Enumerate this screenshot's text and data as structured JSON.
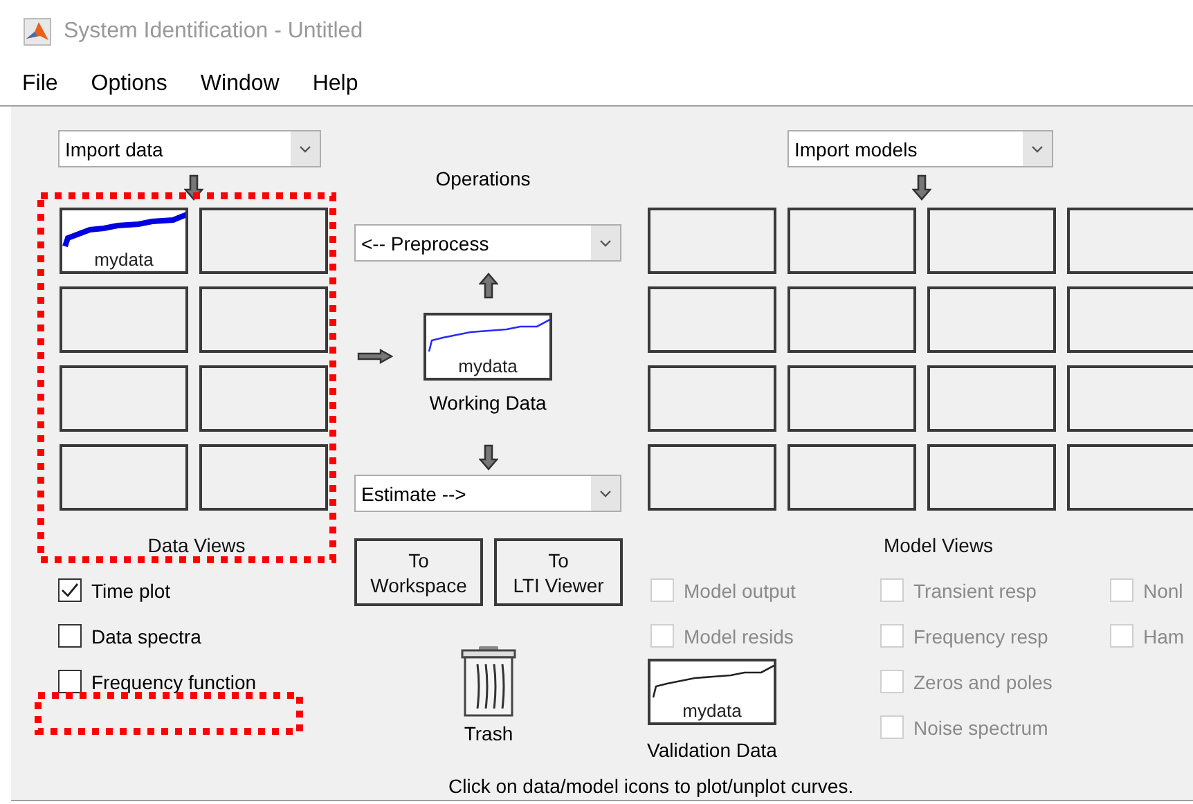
{
  "window": {
    "title": "System Identification - Untitled"
  },
  "menu": [
    "File",
    "Options",
    "Window",
    "Help"
  ],
  "data_section": {
    "dropdown": "Import data",
    "title": "Data Views",
    "tiles": [
      {
        "kind": "data",
        "label": "mydata"
      },
      {
        "kind": "empty"
      },
      {
        "kind": "empty"
      },
      {
        "kind": "empty"
      },
      {
        "kind": "empty"
      },
      {
        "kind": "empty"
      },
      {
        "kind": "empty"
      },
      {
        "kind": "empty"
      }
    ]
  },
  "data_views": [
    {
      "label": "Time plot",
      "checked": true,
      "disabled": false
    },
    {
      "label": "Data spectra",
      "checked": false,
      "disabled": false
    },
    {
      "label": "Frequency function",
      "checked": false,
      "disabled": false
    }
  ],
  "operations": {
    "title": "Operations",
    "preprocess": "<-- Preprocess",
    "working_data": {
      "label": "mydata",
      "caption": "Working Data"
    },
    "estimate": "Estimate -->",
    "buttons": [
      "To\nWorkspace",
      "To\nLTI Viewer"
    ],
    "trash": "Trash"
  },
  "model_section": {
    "dropdown": "Import models",
    "title": "Model Views",
    "tiles": [
      {
        "kind": "empty"
      },
      {
        "kind": "empty"
      },
      {
        "kind": "empty"
      },
      {
        "kind": "empty"
      },
      {
        "kind": "empty"
      },
      {
        "kind": "empty"
      },
      {
        "kind": "empty"
      },
      {
        "kind": "empty"
      },
      {
        "kind": "empty"
      },
      {
        "kind": "empty"
      },
      {
        "kind": "empty"
      },
      {
        "kind": "empty"
      },
      {
        "kind": "empty"
      },
      {
        "kind": "empty"
      },
      {
        "kind": "empty"
      },
      {
        "kind": "empty"
      }
    ]
  },
  "model_view_columns": [
    {
      "items": [
        {
          "label": "Model output",
          "checked": false,
          "disabled": true
        },
        {
          "label": "Model resids",
          "checked": false,
          "disabled": true
        }
      ]
    },
    {
      "items": [
        {
          "label": "Transient resp",
          "checked": false,
          "disabled": true
        },
        {
          "label": "Frequency resp",
          "checked": false,
          "disabled": true
        },
        {
          "label": "Zeros and poles",
          "checked": false,
          "disabled": true
        },
        {
          "label": "Noise spectrum",
          "checked": false,
          "disabled": true
        }
      ]
    },
    {
      "items": [
        {
          "label": "Nonl",
          "checked": false,
          "disabled": true
        },
        {
          "label": "Ham",
          "checked": false,
          "disabled": true
        }
      ]
    }
  ],
  "validation_data": {
    "label": "mydata",
    "caption": "Validation Data"
  },
  "status": "Click on data/model icons to plot/unplot curves.",
  "annotations": [
    {
      "kind": "dotted-frame"
    },
    {
      "kind": "dotted-frame"
    }
  ]
}
